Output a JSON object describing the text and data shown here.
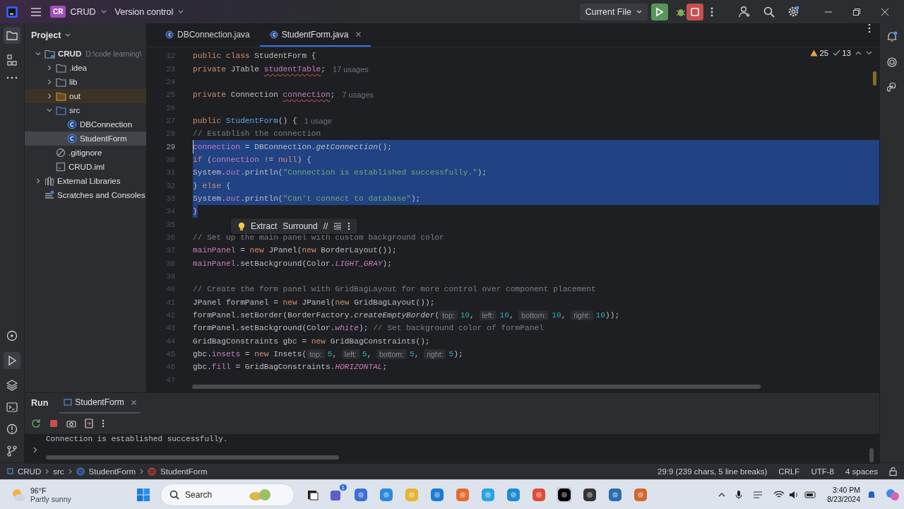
{
  "title_bar": {
    "project_badge": "CR",
    "project": "CRUD",
    "vcs": "Version control",
    "run_config": "Current File"
  },
  "project_panel": {
    "title": "Project",
    "tree": [
      {
        "label": "CRUD",
        "kind": "module",
        "path": "D:\\code learning\\",
        "expanded": true,
        "selected": false,
        "children": [
          {
            "label": ".idea",
            "kind": "folder",
            "expanded": false,
            "selected": false
          },
          {
            "label": "lib",
            "kind": "folder",
            "expanded": false,
            "selected": false
          },
          {
            "label": "out",
            "kind": "excluded",
            "expanded": false,
            "selected": false
          },
          {
            "label": "src",
            "kind": "source",
            "expanded": true,
            "selected": false,
            "children": [
              {
                "label": "DBConnection",
                "kind": "class",
                "selected": false
              },
              {
                "label": "StudentForm",
                "kind": "class",
                "selected": true
              }
            ]
          },
          {
            "label": ".gitignore",
            "kind": "ignore",
            "selected": false
          },
          {
            "label": "CRUD.iml",
            "kind": "iml",
            "selected": false
          }
        ]
      },
      {
        "label": "External Libraries",
        "kind": "libraries",
        "expanded": false,
        "selected": false
      },
      {
        "label": "Scratches and Consoles",
        "kind": "scratches",
        "selected": false
      }
    ]
  },
  "editor": {
    "tabs": [
      {
        "label": "DBConnection.java",
        "selected": false
      },
      {
        "label": "StudentForm.java",
        "selected": true
      }
    ],
    "warnings": "25",
    "checks": "13",
    "lines": [
      {
        "n": "12",
        "parts": [
          {
            "kind": "kw",
            "text": "public"
          },
          {
            "kind": "kw",
            "text": " class"
          },
          {
            "kind": "plain",
            "text": " StudentForm {"
          }
        ]
      },
      {
        "n": "23",
        "parts": [
          {
            "kind": "kw",
            "text": "    private"
          },
          {
            "kind": "plain",
            "text": " JTable "
          },
          {
            "kind": "field_warn",
            "text": "studentTable"
          },
          {
            "kind": "plain",
            "text": ";"
          },
          {
            "kind": "usage",
            "text": "17 usages"
          }
        ]
      },
      {
        "n": "24"
      },
      {
        "n": "25",
        "parts": [
          {
            "kind": "kw",
            "text": "    private"
          },
          {
            "kind": "plain",
            "text": " Connection "
          },
          {
            "kind": "field_warn",
            "text": "connection"
          },
          {
            "kind": "plain",
            "text": ";"
          },
          {
            "kind": "usage",
            "text": "7 usages"
          }
        ]
      },
      {
        "n": "26"
      },
      {
        "n": "27",
        "parts": [
          {
            "kind": "kw",
            "text": "    public"
          },
          {
            "kind": "method_decl",
            "text": " StudentForm"
          },
          {
            "kind": "plain",
            "text": "() {"
          },
          {
            "kind": "usage",
            "text": "1 usage"
          }
        ]
      },
      {
        "n": "28",
        "parts": [
          {
            "kind": "comment",
            "text": "        // Establish the connection"
          }
        ]
      },
      {
        "n": "29",
        "current": true,
        "selected": true,
        "parts": [
          {
            "kind": "field",
            "text": "        connection"
          },
          {
            "kind": "plain",
            "text": " = DBConnection."
          },
          {
            "kind": "static_method",
            "text": "getConnection"
          },
          {
            "kind": "plain",
            "text": "();"
          }
        ]
      },
      {
        "n": "30",
        "selected": true,
        "parts": [
          {
            "kind": "kw",
            "text": "        if"
          },
          {
            "kind": "plain",
            "text": " ("
          },
          {
            "kind": "field",
            "text": "connection"
          },
          {
            "kind": "plain",
            "text": " != "
          },
          {
            "kind": "kw",
            "text": "null"
          },
          {
            "kind": "plain",
            "text": ") {"
          }
        ]
      },
      {
        "n": "31",
        "selected": true,
        "parts": [
          {
            "kind": "plain",
            "text": "            System."
          },
          {
            "kind": "static",
            "text": "out"
          },
          {
            "kind": "plain",
            "text": ".println("
          },
          {
            "kind": "str",
            "text": "\"Connection is established successfully.\""
          },
          {
            "kind": "plain",
            "text": ");"
          }
        ]
      },
      {
        "n": "32",
        "selected": true,
        "parts": [
          {
            "kind": "plain",
            "text": "        } "
          },
          {
            "kind": "kw",
            "text": "else"
          },
          {
            "kind": "plain",
            "text": " {"
          }
        ]
      },
      {
        "n": "33",
        "selected": true,
        "parts": [
          {
            "kind": "plain",
            "text": "            System."
          },
          {
            "kind": "static",
            "text": "out"
          },
          {
            "kind": "plain",
            "text": ".println("
          },
          {
            "kind": "str",
            "text": "\"Can't connect to database\""
          },
          {
            "kind": "plain",
            "text": ");"
          }
        ]
      },
      {
        "n": "34",
        "selected": true,
        "parts": [
          {
            "kind": "plain",
            "text": "        }"
          }
        ]
      },
      {
        "n": "35"
      },
      {
        "n": "36",
        "parts": [
          {
            "kind": "comment",
            "text": "        // Set up the main panel with custom background color"
          }
        ]
      },
      {
        "n": "37",
        "parts": [
          {
            "kind": "field",
            "text": "        mainPanel"
          },
          {
            "kind": "plain",
            "text": " = "
          },
          {
            "kind": "kw",
            "text": "new"
          },
          {
            "kind": "plain",
            "text": " JPanel("
          },
          {
            "kind": "kw",
            "text": "new"
          },
          {
            "kind": "plain",
            "text": " BorderLayout());"
          }
        ]
      },
      {
        "n": "38",
        "parts": [
          {
            "kind": "field",
            "text": "        mainPanel"
          },
          {
            "kind": "plain",
            "text": ".setBackground(Color."
          },
          {
            "kind": "static",
            "text": "LIGHT_GRAY"
          },
          {
            "kind": "plain",
            "text": ");"
          }
        ]
      },
      {
        "n": "39"
      },
      {
        "n": "40",
        "parts": [
          {
            "kind": "comment",
            "text": "        // Create the form panel with GridBagLayout for more control over component placement"
          }
        ]
      },
      {
        "n": "41",
        "parts": [
          {
            "kind": "plain",
            "text": "        JPanel formPanel = "
          },
          {
            "kind": "kw",
            "text": "new"
          },
          {
            "kind": "plain",
            "text": " JPanel("
          },
          {
            "kind": "kw",
            "text": "new"
          },
          {
            "kind": "plain",
            "text": " GridBagLayout());"
          }
        ]
      },
      {
        "n": "42",
        "parts": [
          {
            "kind": "plain",
            "text": "        formPanel.setBorder(BorderFactory."
          },
          {
            "kind": "static_method",
            "text": "createEmptyBorder"
          },
          {
            "kind": "plain",
            "text": "("
          },
          {
            "kind": "hint",
            "text": "top:"
          },
          {
            "kind": "num",
            "text": "10"
          },
          {
            "kind": "plain",
            "text": ", "
          },
          {
            "kind": "hint",
            "text": "left:"
          },
          {
            "kind": "num",
            "text": "10"
          },
          {
            "kind": "plain",
            "text": ", "
          },
          {
            "kind": "hint",
            "text": "bottom:"
          },
          {
            "kind": "num",
            "text": "10"
          },
          {
            "kind": "plain",
            "text": ", "
          },
          {
            "kind": "hint",
            "text": "right:"
          },
          {
            "kind": "num",
            "text": "10"
          },
          {
            "kind": "plain",
            "text": "));"
          }
        ]
      },
      {
        "n": "43",
        "parts": [
          {
            "kind": "plain",
            "text": "        formPanel.setBackground(Color."
          },
          {
            "kind": "static",
            "text": "white"
          },
          {
            "kind": "plain",
            "text": "); "
          },
          {
            "kind": "comment",
            "text": "// Set background color of formPanel"
          }
        ]
      },
      {
        "n": "44",
        "parts": [
          {
            "kind": "plain",
            "text": "        GridBagConstraints gbc = "
          },
          {
            "kind": "kw",
            "text": "new"
          },
          {
            "kind": "plain",
            "text": " GridBagConstraints();"
          }
        ]
      },
      {
        "n": "45",
        "parts": [
          {
            "kind": "plain",
            "text": "        gbc."
          },
          {
            "kind": "field",
            "text": "insets"
          },
          {
            "kind": "plain",
            "text": " = "
          },
          {
            "kind": "kw",
            "text": "new"
          },
          {
            "kind": "plain",
            "text": " Insets("
          },
          {
            "kind": "hint",
            "text": "top:"
          },
          {
            "kind": "num",
            "text": "5"
          },
          {
            "kind": "plain",
            "text": ", "
          },
          {
            "kind": "hint",
            "text": "left:"
          },
          {
            "kind": "num",
            "text": "5"
          },
          {
            "kind": "plain",
            "text": ", "
          },
          {
            "kind": "hint",
            "text": "bottom:"
          },
          {
            "kind": "num",
            "text": "5"
          },
          {
            "kind": "plain",
            "text": ", "
          },
          {
            "kind": "hint",
            "text": "right:"
          },
          {
            "kind": "num",
            "text": "5"
          },
          {
            "kind": "plain",
            "text": ");"
          }
        ]
      },
      {
        "n": "46",
        "parts": [
          {
            "kind": "plain",
            "text": "        gbc."
          },
          {
            "kind": "field",
            "text": "fill"
          },
          {
            "kind": "plain",
            "text": " = GridBagConstraints."
          },
          {
            "kind": "static",
            "text": "HORIZONTAL"
          },
          {
            "kind": "plain",
            "text": ";"
          }
        ]
      },
      {
        "n": "47"
      }
    ],
    "popup": {
      "actions": [
        "Extract",
        "Surround"
      ],
      "comment_action": "//"
    }
  },
  "run_panel": {
    "title": "Run",
    "tabs": [
      {
        "label": "StudentForm",
        "selected": true
      }
    ],
    "output": [
      "Connection is established successfully."
    ]
  },
  "status_bar": {
    "breadcrumbs": [
      {
        "label": "CRUD",
        "kind": "module"
      },
      {
        "label": "src",
        "kind": "folder"
      },
      {
        "label": "StudentForm",
        "kind": "class"
      },
      {
        "label": "StudentForm",
        "kind": "method"
      }
    ],
    "position": "29:9 (239 chars, 5 line breaks)",
    "line_separator": "CRLF",
    "encoding": "UTF-8",
    "indent": "4 spaces"
  },
  "taskbar": {
    "temperature": "96°F",
    "condition": "Partly sunny",
    "search_placeholder": "Search",
    "chat_badge": "1",
    "time": "3:40 PM",
    "date": "8/23/2024"
  }
}
